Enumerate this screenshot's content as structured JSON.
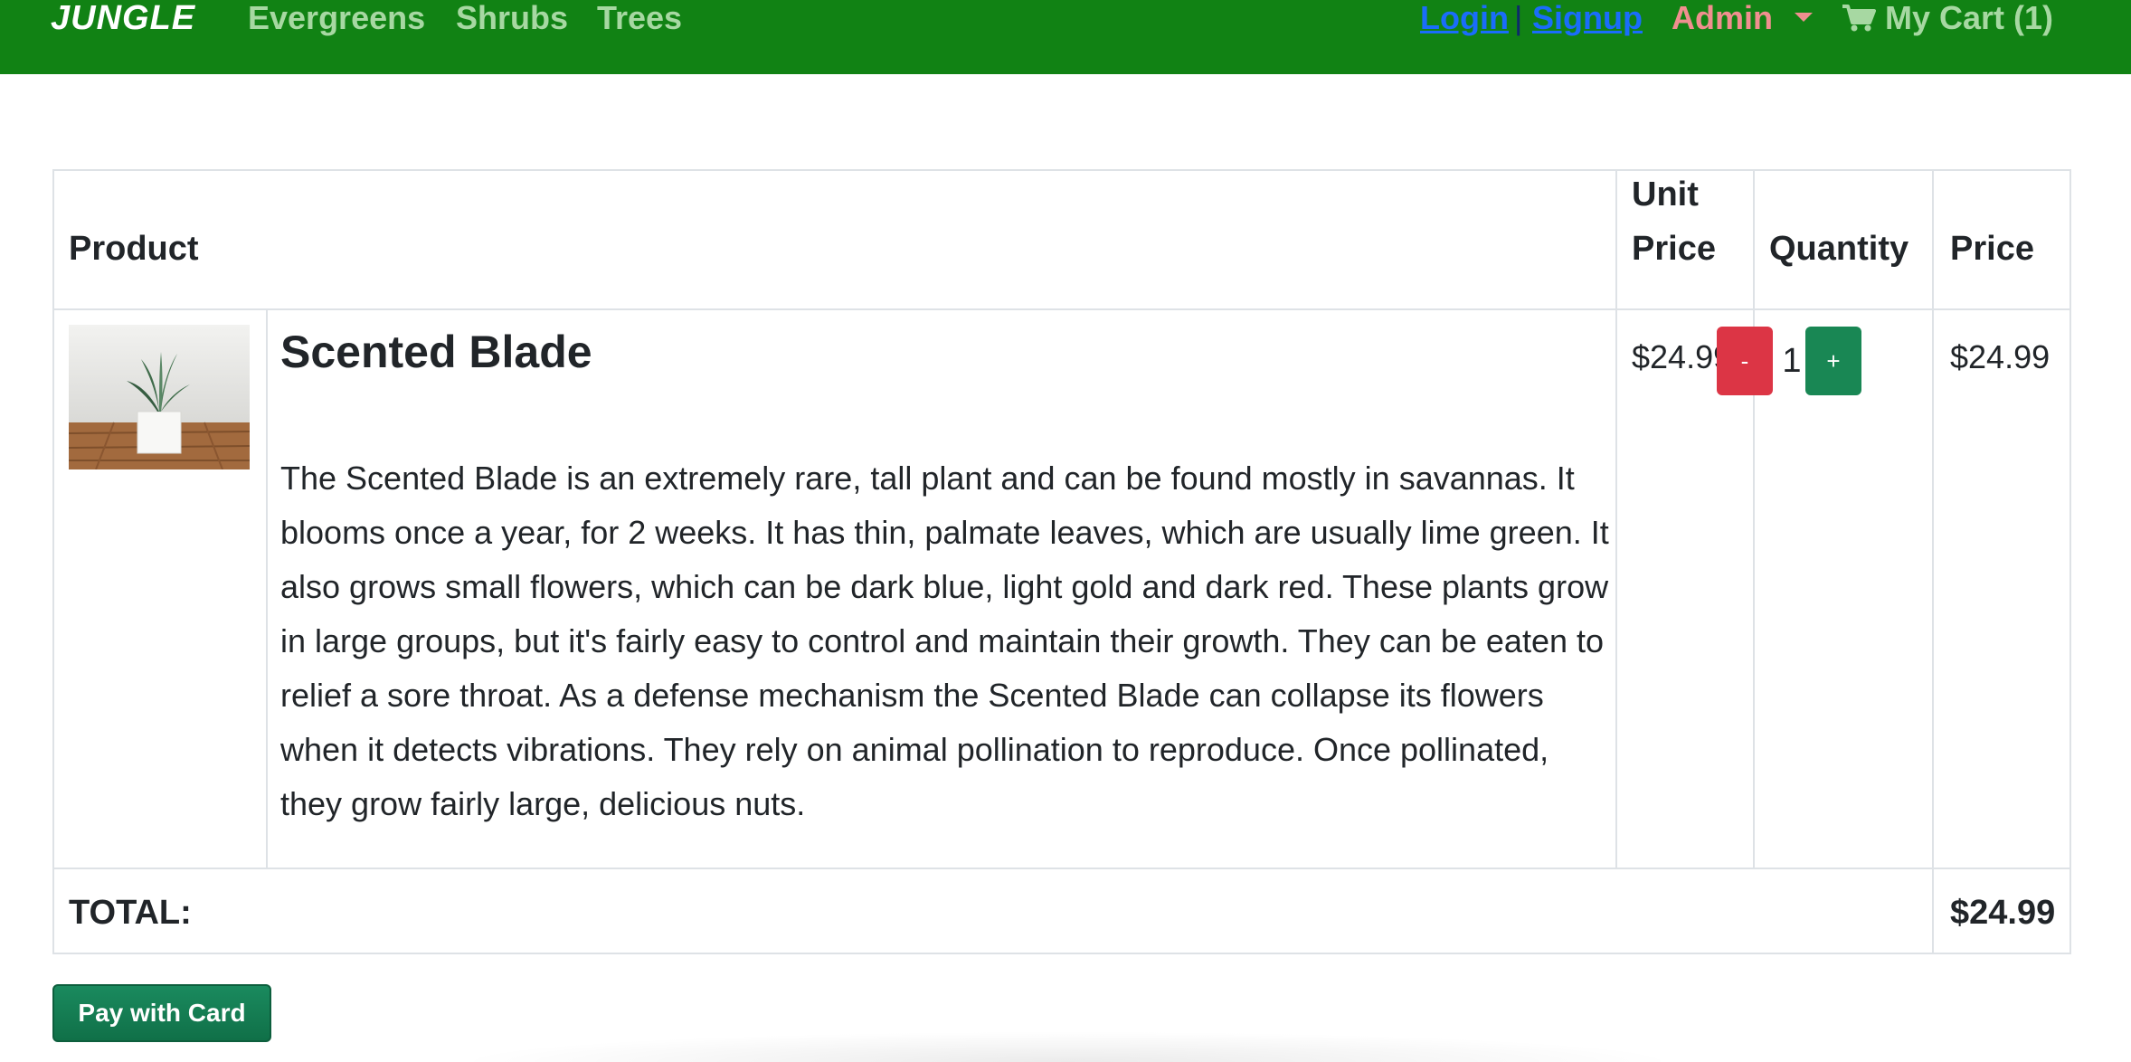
{
  "nav": {
    "brand": "JUNGLE",
    "links": [
      "Evergreens",
      "Shrubs",
      "Trees"
    ],
    "login": "Login",
    "separator": "|",
    "signup": "Signup",
    "admin": "Admin",
    "cart": "My Cart (1)"
  },
  "cart": {
    "headers": {
      "product": "Product",
      "unit_price_line1": "Unit",
      "unit_price_line2": "Price",
      "quantity": "Quantity",
      "price": "Price"
    },
    "item": {
      "name": "Scented Blade",
      "description": "The Scented Blade is an extremely rare, tall plant and can be found mostly in savannas. It blooms once a year, for 2 weeks. It has thin, palmate leaves, which are usually lime green. It also grows small flowers, which can be dark blue, light gold and dark red. These plants grow in large groups, but it's fairly easy to control and maintain their growth. They can be eaten to relief a sore throat. As a defense mechanism the Scented Blade can collapse its flowers when it detects vibrations. They rely on animal pollination to reproduce. Once pollinated, they grow fairly large, delicious nuts.",
      "unit_price": "$24.99",
      "quantity": "1",
      "minus_label": "-",
      "plus_label": "+",
      "price": "$24.99"
    },
    "total_label": "TOTAL:",
    "total_value": "$24.99"
  },
  "pay_button": "Pay with Card",
  "colors": {
    "navbar": "#118214",
    "nav_link": "#a7d8a2",
    "auth_link": "#1a6dfa",
    "admin": "#f08f8f",
    "minus_button": "#dc3545",
    "plus_button": "#198754",
    "pay_button": "#107048"
  },
  "icons": {
    "cart": "shopping-cart-icon",
    "dropdown": "caret-down-icon"
  }
}
